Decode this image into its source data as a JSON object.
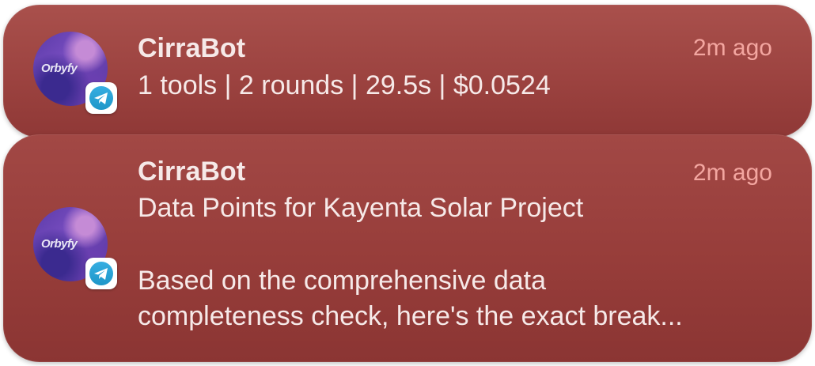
{
  "notifications": [
    {
      "sender": "CirraBot",
      "time": "2m ago",
      "avatar_text": "Orbyfy",
      "app_icon": "telegram-icon",
      "lines": [
        "1 tools | 2 rounds | 29.5s | $0.0524"
      ]
    },
    {
      "sender": "CirraBot",
      "time": "2m ago",
      "avatar_text": "Orbyfy",
      "app_icon": "telegram-icon",
      "lines": [
        "Data Points for Kayenta Solar Project",
        "",
        "Based on the comprehensive data",
        "completeness check, here's the exact break..."
      ]
    }
  ],
  "colors": {
    "card": "#9c4340",
    "sender_text": "#f6e9e8",
    "time_text": "#f3a6a0",
    "telegram_blue": "#2aa3d9"
  }
}
